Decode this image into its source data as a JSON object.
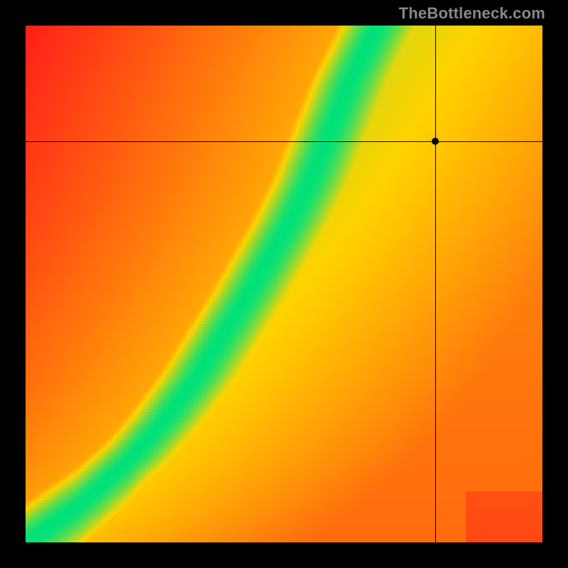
{
  "watermark": "TheBottleneck.com",
  "chart_data": {
    "type": "heatmap",
    "title": "",
    "xlabel": "",
    "ylabel": "",
    "xlim": [
      0,
      1
    ],
    "ylim": [
      0,
      1
    ],
    "color_scale": {
      "low_color": "#ff1a1a",
      "mid_color": "#ffd400",
      "high_color": "#00e27a",
      "meaning_low": "worst match",
      "meaning_high": "best match"
    },
    "optimal_curve_description": "Green ridge indicating ideal pairing; starts at origin, shallow slope to about x=0.3, then steep slope exiting near x=0.68 at top",
    "optimal_curve_points": [
      {
        "x": 0.0,
        "y": 0.0
      },
      {
        "x": 0.1,
        "y": 0.07
      },
      {
        "x": 0.2,
        "y": 0.16
      },
      {
        "x": 0.27,
        "y": 0.24
      },
      {
        "x": 0.33,
        "y": 0.32
      },
      {
        "x": 0.38,
        "y": 0.4
      },
      {
        "x": 0.43,
        "y": 0.48
      },
      {
        "x": 0.47,
        "y": 0.55
      },
      {
        "x": 0.51,
        "y": 0.62
      },
      {
        "x": 0.55,
        "y": 0.7
      },
      {
        "x": 0.59,
        "y": 0.8
      },
      {
        "x": 0.63,
        "y": 0.9
      },
      {
        "x": 0.68,
        "y": 1.0
      }
    ],
    "marker": {
      "x": 0.792,
      "y": 0.776,
      "note": "crosshair intersection with dot; lies to the right of the green ridge"
    },
    "grid": false,
    "legend": false
  }
}
